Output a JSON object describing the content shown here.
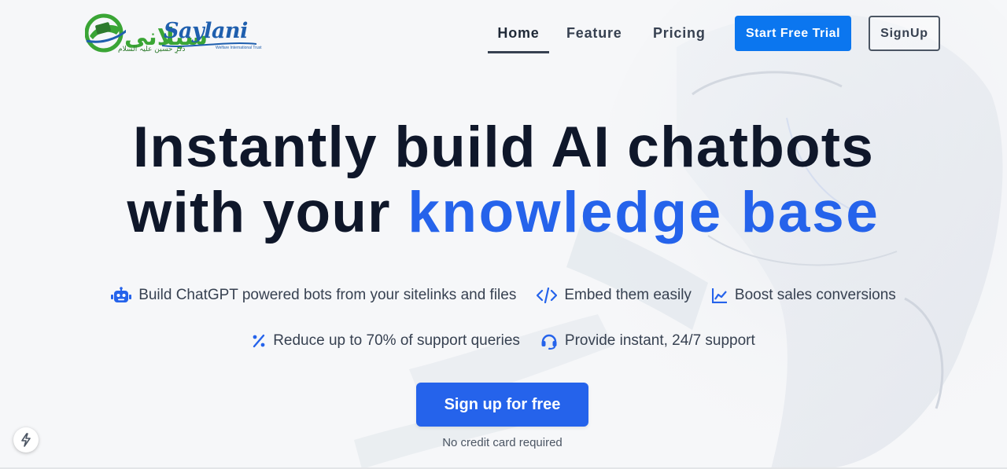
{
  "brand": {
    "logo_latin": "Saylani",
    "logo_urdu": "سیلانی",
    "logo_tagline": "Welfare International Trust",
    "logo_urdu_sub": "ذکرِ حسین علیہ السلام"
  },
  "nav": {
    "items": [
      {
        "label": "Home",
        "active": true
      },
      {
        "label": "Feature"
      },
      {
        "label": "Pricing"
      }
    ],
    "trial_label": "Start Free Trial",
    "signup_label": "SignUp"
  },
  "hero": {
    "title_line1": "Instantly build AI chatbots",
    "title_line2_prefix": "with your ",
    "title_line2_accent": "knowledge base"
  },
  "features": [
    {
      "icon": "robot-icon",
      "text": "Build ChatGPT powered bots from your sitelinks and files"
    },
    {
      "icon": "code-icon",
      "text": "Embed them easily"
    },
    {
      "icon": "chart-line-icon",
      "text": "Boost sales conversions"
    },
    {
      "icon": "percent-icon",
      "text": "Reduce up to 70% of support queries"
    },
    {
      "icon": "headset-icon",
      "text": "Provide instant, 24/7 support"
    }
  ],
  "cta": {
    "label": "Sign up for free",
    "note": "No credit card required"
  },
  "colors": {
    "accent": "#2563eb",
    "trial_button": "#0b76ef",
    "heading": "#0f172a"
  }
}
